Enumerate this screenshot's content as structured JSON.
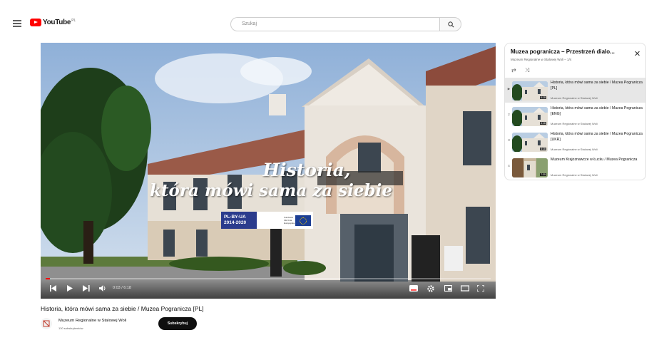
{
  "header": {
    "logo_text": "YouTube",
    "logo_superscript": "PL",
    "search_placeholder": "Szukaj"
  },
  "player": {
    "overlay_line1": "Historia,",
    "overlay_line2": "która mówi sama za siebie",
    "badge_program": "PL-BY-UA 2014-2020",
    "badge_funding": "Fundusze UE Unia Europejska",
    "time": "0:03 / 6:18",
    "progress_fraction": 0.01
  },
  "playlist": {
    "title": "Muzea pogranicza – Przestrzeń dialo...",
    "subtitle": "Muzeum Regionalne w Stalowej Woli – 1/4",
    "close_icon": "close-icon",
    "items": [
      {
        "index": "▶",
        "title": "Historia, która mówi sama za siebie / Muzea Pogranicza [PL]",
        "channel": "Muzeum Regionalne w Stalowej Woli",
        "duration": "6:18",
        "active": true
      },
      {
        "index": "2",
        "title": "Historia, która mówi sama za siebie / Muzea Pogranicza [ENG]",
        "channel": "Muzeum Regionalne w Stalowej Woli",
        "duration": "6:18",
        "active": false
      },
      {
        "index": "3",
        "title": "Historia, która mówi sama za siebie / Muzea Pogranicza [UKR]",
        "channel": "Muzeum Regionalne w Stalowej Woli",
        "duration": "6:18",
        "active": false
      },
      {
        "index": "4",
        "title": "Muzeum Krajoznawcze w Łucku / Muzea Pogranicza",
        "channel": "Muzeum Regionalne w Stalowej Woli",
        "duration": "7:35",
        "active": false
      }
    ]
  },
  "video": {
    "title": "Historia, która mówi sama za siebie / Muzea Pogranicza [PL]",
    "channel_name": "Muzeum Regionalne w Stalowej Woli",
    "subscribers": "130 subskrybentów",
    "subscribe_label": "Subskrybuj"
  },
  "colors": {
    "brand_red": "#ff0000",
    "dark_button": "#0f0f0f"
  }
}
